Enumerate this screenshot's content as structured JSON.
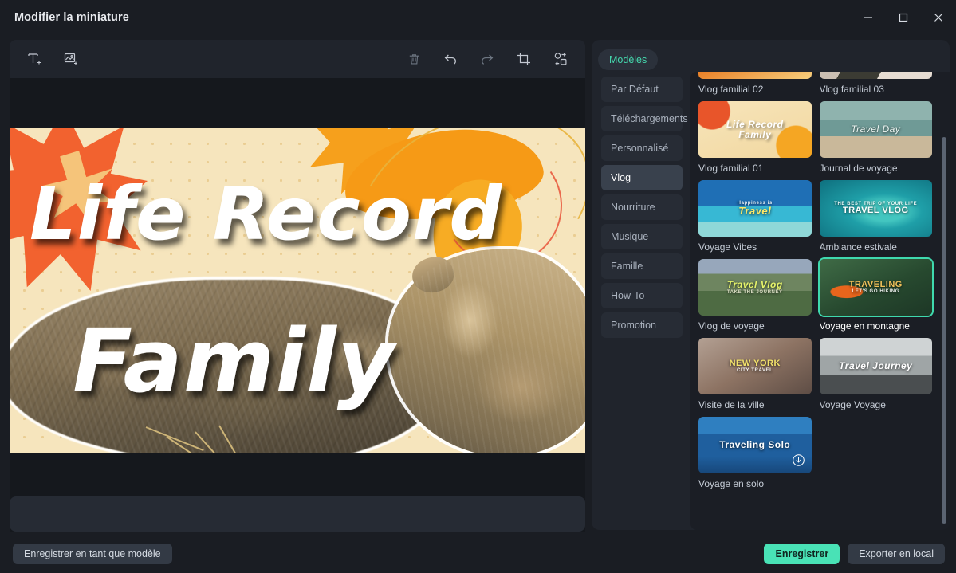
{
  "window": {
    "title": "Modifier la miniature",
    "minimize_icon": "minimize-icon",
    "maximize_icon": "maximize-icon",
    "close_icon": "close-icon"
  },
  "toolbar": {
    "add_text_icon": "add-text-icon",
    "add_image_icon": "add-image-icon",
    "delete_icon": "trash-icon",
    "undo_icon": "undo-icon",
    "redo_icon": "redo-icon",
    "crop_icon": "crop-icon",
    "remove_background_icon": "remove-background-icon"
  },
  "canvas": {
    "artwork_line1": "Life Record",
    "artwork_line2": "Family"
  },
  "panel": {
    "tab_label": "Modèles",
    "categories": [
      {
        "label": "Par Défaut",
        "active": false
      },
      {
        "label": "Téléchargements",
        "active": false
      },
      {
        "label": "Personnalisé",
        "active": false
      },
      {
        "label": "Vlog",
        "active": true
      },
      {
        "label": "Nourriture",
        "active": false
      },
      {
        "label": "Musique",
        "active": false
      },
      {
        "label": "Famille",
        "active": false
      },
      {
        "label": "How-To",
        "active": false
      },
      {
        "label": "Promotion",
        "active": false
      }
    ],
    "templates": [
      {
        "label": "Vlog familial 02",
        "selected": false,
        "art": "orange-food",
        "art_text": "",
        "art_sub": ""
      },
      {
        "label": "Vlog familial 03",
        "selected": false,
        "art": "collage-light",
        "art_text": "",
        "art_sub": ""
      },
      {
        "label": "Vlog familial 01",
        "selected": false,
        "art": "life-record",
        "art_text": "Life Record",
        "art_sub": "Family"
      },
      {
        "label": "Journal de voyage",
        "selected": false,
        "art": "beach-surfer",
        "art_text": "Travel Day",
        "art_sub": ""
      },
      {
        "label": "Voyage Vibes",
        "selected": false,
        "art": "tropical-couple",
        "art_text": "Travel",
        "art_sub": "Happiness is"
      },
      {
        "label": "Ambiance estivale",
        "selected": false,
        "art": "turquoise-reef",
        "art_text": "TRAVEL VLOG",
        "art_sub": "THE BEST TRIP OF YOUR LIFE"
      },
      {
        "label": "Vlog de voyage",
        "selected": false,
        "art": "mountain-valley",
        "art_text": "Travel Vlog",
        "art_sub": "TAKE THE JOURNEY"
      },
      {
        "label": "Voyage en montagne",
        "selected": true,
        "art": "hiker-forest",
        "art_text": "TRAVELING",
        "art_sub": "LET'S GO HIKING"
      },
      {
        "label": "Visite de la ville",
        "selected": false,
        "art": "new-york-friends",
        "art_text": "NEW YORK",
        "art_sub": "CITY TRAVEL"
      },
      {
        "label": "Voyage Voyage",
        "selected": false,
        "art": "grey-beach",
        "art_text": "Travel Journey",
        "art_sub": ""
      },
      {
        "label": "Voyage en solo",
        "selected": false,
        "art": "blue-sea-boat",
        "art_text": "Traveling Solo",
        "art_sub": ""
      }
    ]
  },
  "footer": {
    "save_as_template_label": "Enregistrer en tant que modèle",
    "save_label": "Enregistrer",
    "export_label": "Exporter en local"
  },
  "colors": {
    "accent": "#49e2b6",
    "panel_bg": "#20242c",
    "window_bg": "#1a1d23",
    "canvas_bg": "#15181d"
  }
}
